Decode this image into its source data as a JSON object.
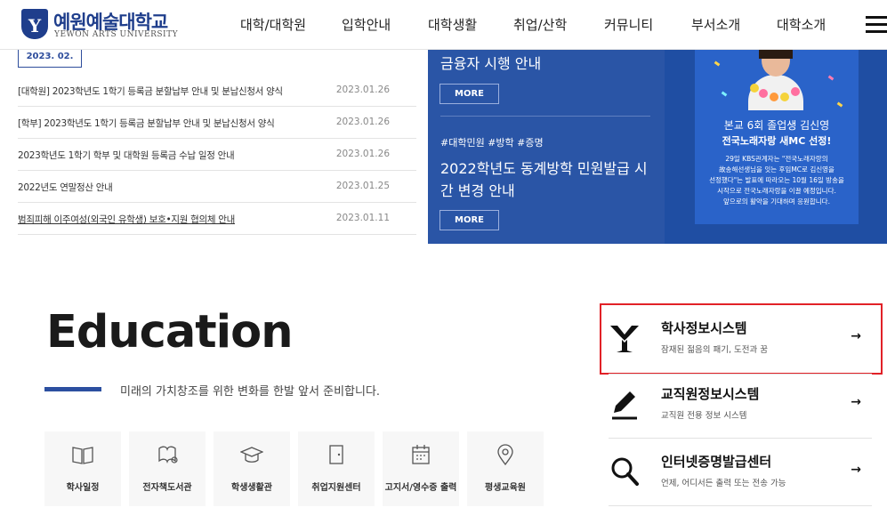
{
  "header": {
    "logo": {
      "title": "예원예술대학교",
      "subtitle": "YEWON ARTS UNIVERSITY",
      "emblem": "Y"
    },
    "nav": [
      "대학/대학원",
      "입학안내",
      "대학생활",
      "취업/산학",
      "커뮤니티",
      "부서소개",
      "대학소개"
    ],
    "menu_icon": "hamburger-icon"
  },
  "notices": {
    "date_tag": "2023. 02.",
    "items": [
      {
        "title": "[대학원] 2023학년도 1학기 등록금 분할납부 안내 및 분납신청서 양식",
        "date": "2023.01.26"
      },
      {
        "title": "[학부] 2023학년도 1학기 등록금 분할납부 안내 및 분납신청서 양식",
        "date": "2023.01.26"
      },
      {
        "title": "2023학년도 1학기 학부 및 대학원 등록금 수납 일정 안내",
        "date": "2023.01.26"
      },
      {
        "title": "2022년도 연말정산 안내",
        "date": "2023.01.25"
      },
      {
        "title": "범죄피해 이주여성(외국인 유학생) 보호•지원 협의체 안내",
        "date": "2023.01.11"
      }
    ]
  },
  "feature": {
    "top_title": "금융자 시행 안내",
    "more_label": "MORE",
    "tags": "#대학민원 #방학 #증명",
    "title_line1": "2022학년도 동계방학 민원발급 시",
    "title_line2": "간 변경 안내",
    "more_label_2": "MORE",
    "bg_color": "#2a55a6"
  },
  "promo": {
    "line1": "본교 6회 졸업생 김신영",
    "line2": "전국노래자랑 새MC 선정!",
    "body": [
      "29일 KBS관계자는 \"전국노래자랑의",
      "故송해선생님을 잇는 후임MC로 김신영을",
      "선정했다\"는 발표에 따라오는 10월 16일 방송을",
      "시작으로 전국노래자랑을 이끌 예정입니다.",
      "앞으로의 활약을 기대하며 응원합니다."
    ]
  },
  "education": {
    "title": "Education",
    "subtitle": "미래의 가치창조를 위한 변화를 한발 앞서 준비합니다.",
    "accent_color": "#2c4fa0",
    "quick_links": [
      {
        "label": "학사일정",
        "icon": "book-icon"
      },
      {
        "label": "전자책도서관",
        "icon": "ebook-icon"
      },
      {
        "label": "학생생활관",
        "icon": "graduation-cap-icon"
      },
      {
        "label": "취업지원센터",
        "icon": "door-icon"
      },
      {
        "label": "고지서/영수증 출력",
        "icon": "calendar-icon"
      },
      {
        "label": "평생교육원",
        "icon": "location-pin-icon"
      }
    ]
  },
  "systems": [
    {
      "name": "학사정보시스템",
      "desc": "잠재된 젊음의 패기, 도전과 꿈",
      "icon": "university-logo-icon",
      "arrow": "→",
      "highlighted": true
    },
    {
      "name": "교직원정보시스템",
      "desc": "교직원 전용 정보 시스템",
      "icon": "pen-icon",
      "arrow": "→"
    },
    {
      "name": "인터넷증명발급센터",
      "desc": "언제, 어디서든 출력 또는 전송 가능",
      "icon": "search-icon",
      "arrow": "→"
    }
  ],
  "colors": {
    "brand": "#1f3e8c",
    "highlight": "#e12127"
  }
}
